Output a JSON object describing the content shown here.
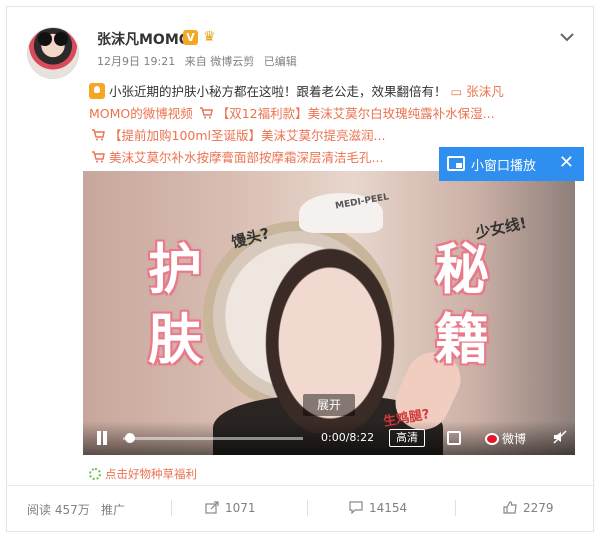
{
  "post": {
    "author": "张沫凡MOMO",
    "verified_badge": "V",
    "meta": {
      "date": "12月9日 19:21",
      "source": "来自 微博云剪",
      "edited": "已编辑"
    },
    "text": {
      "line1": "小张近期的护肤小秘方都在这啦！跟着老公走，效果翻倍有！",
      "video_link_part1": "张沫凡",
      "video_link_part2": "MOMO的微博视频",
      "product1": "【双12福利款】美沫艾莫尔白玫瑰纯露补水保湿...",
      "product2": "【提前加购100ml圣诞版】美沫艾莫尔提亮滋润...",
      "product3": "美沫艾莫尔补水按摩膏面部按摩霜深层清洁毛孔..."
    }
  },
  "video": {
    "overlay": {
      "left_top": "护",
      "left_bottom": "肤",
      "right_top": "秘",
      "right_bottom": "籍",
      "tag_a": "馒头?",
      "tag_b": "少女线!",
      "tag_c": "生鸡腿?",
      "band": "MEDI-PEEL"
    },
    "expand_label": "展开",
    "time": "0:00/8:22",
    "quality": "高清",
    "brand": "微博",
    "progress": 0.0
  },
  "popout": {
    "label": "小窗口播放",
    "close": "✕"
  },
  "mark_link": "点击好物种草福利",
  "actions": {
    "read": "阅读 457万",
    "promote": "推广",
    "forward": "1071",
    "comment": "14154",
    "like": "2279"
  },
  "colors": {
    "accent": "#eb7350",
    "popout_bg": "#2f8ff0",
    "badge": "#f5a623"
  },
  "icons": [
    "bulb-icon",
    "video-icon",
    "cart-icon",
    "chevron-down-icon",
    "forward-icon",
    "comment-icon",
    "like-icon",
    "play-icon",
    "fullscreen-icon",
    "mute-icon",
    "mini-window-icon",
    "close-icon",
    "flower-icon"
  ]
}
